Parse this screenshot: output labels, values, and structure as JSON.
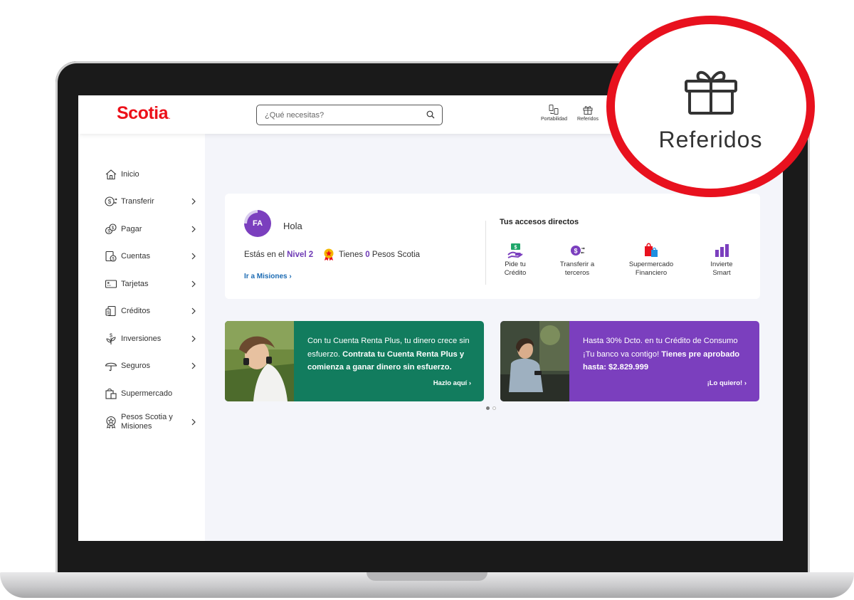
{
  "brand": {
    "name": "Scotia",
    "dot": ".",
    "color": "#ec111a"
  },
  "search": {
    "placeholder": "¿Qué necesitas?"
  },
  "header_icons": [
    {
      "label": "Portabilidad",
      "icon": "portability-icon"
    },
    {
      "label": "Referidos",
      "icon": "gift-icon"
    }
  ],
  "sidebar": {
    "items": [
      {
        "label": "Inicio",
        "icon": "home-icon",
        "has_chevron": false
      },
      {
        "label": "Transferir",
        "icon": "transfer-icon",
        "has_chevron": true
      },
      {
        "label": "Pagar",
        "icon": "coins-icon",
        "has_chevron": true
      },
      {
        "label": "Cuentas",
        "icon": "accounts-icon",
        "has_chevron": true
      },
      {
        "label": "Tarjetas",
        "icon": "card-icon",
        "has_chevron": true
      },
      {
        "label": "Créditos",
        "icon": "credit-icon",
        "has_chevron": true
      },
      {
        "label": "Inversiones",
        "icon": "plant-icon",
        "has_chevron": true
      },
      {
        "label": "Seguros",
        "icon": "umbrella-icon",
        "has_chevron": true
      },
      {
        "label": "Supermercado",
        "icon": "shopping-bag-icon",
        "has_chevron": false
      },
      {
        "label": "Pesos Scotia y Misiones",
        "icon": "medal-icon",
        "has_chevron": true
      }
    ]
  },
  "welcome": {
    "initials": "FA",
    "greeting": "Hola",
    "level_prefix": "Estás en el",
    "level": "Nivel 2",
    "pesos_prefix": "Tienes",
    "pesos_amount": "0",
    "pesos_suffix": "Pesos Scotia",
    "missions_link": "Ir a Misiones ›"
  },
  "shortcuts": {
    "title": "Tus accesos directos",
    "items": [
      {
        "line1": "Pide tu",
        "line2": "Crédito",
        "icon": "cash-hand-icon"
      },
      {
        "line1": "Transferir a",
        "line2": "terceros",
        "icon": "transfer-coin-icon"
      },
      {
        "line1": "Supermercado",
        "line2": "Financiero",
        "icon": "shopping-bags-icon"
      },
      {
        "line1": "Invierte",
        "line2": "Smart",
        "icon": "bar-chart-icon"
      }
    ]
  },
  "banners": [
    {
      "text_normal": "Con tu Cuenta Renta Plus, tu dinero crece sin esfuerzo. ",
      "text_bold": "Contrata tu Cuenta Renta Plus y comienza a ganar dinero sin esfuerzo.",
      "cta": "Hazlo aquí ›",
      "color": "#127c5e"
    },
    {
      "text_normal": "Hasta 30% Dcto. en tu Crédito de Consumo ¡Tu banco va contigo! ",
      "text_bold": "Tienes pre aprobado hasta: $2.829.999",
      "cta": "¡Lo quiero! ›",
      "color": "#7b3fbe"
    }
  ],
  "carousel": {
    "active_index": 0,
    "count": 2
  },
  "callout": {
    "label": "Referidos",
    "icon": "gift-icon",
    "ring_color": "#e8111e"
  }
}
